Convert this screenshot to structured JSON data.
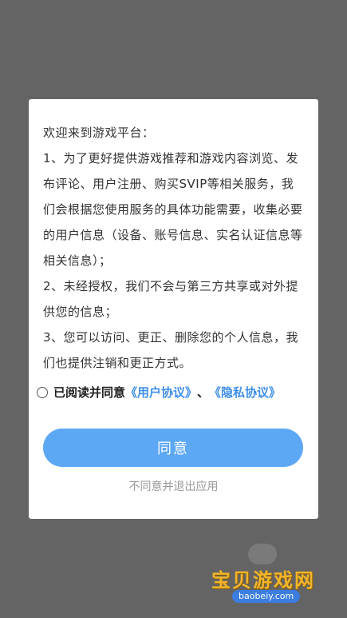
{
  "dialog": {
    "paragraphs": [
      "欢迎来到游戏平台：",
      "1、为了更好提供游戏推荐和游戏内容浏览、发布评论、用户注册、购买SVIP等相关服务，我们会根据您使用服务的具体功能需要，收集必要的用户信息（设备、账号信息、实名认证信息等相关信息）；",
      "2、未经授权，我们不会与第三方共享或对外提供您的信息；",
      "3、您可以访问、更正、删除您的个人信息，我们也提供注销和更正方式。"
    ],
    "consent": {
      "checked": false,
      "prefix": "已阅读并同意",
      "user_agreement": "《用户协议》",
      "separator": "、",
      "privacy_agreement": "《隐私协议》"
    },
    "agree_label": "同意",
    "reject_label": "不同意并退出应用"
  },
  "watermark": {
    "title": "宝贝游戏网",
    "url": "baobeiy.com"
  },
  "colors": {
    "overlay": "#646464",
    "link": "#3f8fe8",
    "primary_button": "#5da8f4",
    "watermark_gold": "#f1b52a"
  }
}
